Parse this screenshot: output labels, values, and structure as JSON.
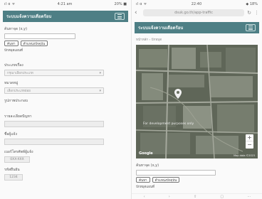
{
  "left": {
    "status": {
      "carrier": "ıl ɑ ᯤ",
      "time": "4:21 am",
      "battery": "20% ■"
    },
    "header": {
      "title": "ระบบแจ้งความเดือดร้อน"
    },
    "search": {
      "label": "ค้นหาจุด (x,y)",
      "placeholder": "",
      "btn_search": "ค้นหา",
      "btn_location": "ตำแหน่งปัจจุบัน",
      "note": "ปักหมุดแผนที่"
    },
    "form": {
      "type_label": "ประเภทเรื่อง",
      "type_value": "กรุณาเลือกประเภท",
      "subtype_label": "หมวดหมู่",
      "subtype_value": "เลือกประเภทย่อย",
      "photo_label": "รูปภาพประกอบ",
      "desc_label": "รายละเอียดปัญหา",
      "name_label": "ชื่อผู้แจ้ง",
      "phone_label": "เบอร์โทรศัพท์ผู้แจ้ง",
      "phone_value": "0XX-XXX",
      "code_label": "รหัสยืนยัน",
      "code_value": "1234"
    }
  },
  "right": {
    "status": {
      "carrier": "ıl ɑ ᯤ",
      "time": "22:40",
      "battery": "◆ 18%"
    },
    "browser": {
      "back": "‹",
      "url": "dsuk.go.th/app-traffic",
      "refresh": "↻",
      "more": "⋮"
    },
    "header": {
      "title": "ระบบแจ้งความเดือดร้อน"
    },
    "breadcrumb": "หน้าหลัก  ›  ปักหมุด",
    "map": {
      "label": "For development purposes only",
      "zoom_in": "+",
      "zoom_out": "−",
      "brand": "Google",
      "terms": "Map data ©2023"
    },
    "search": {
      "label": "ค้นหาจุด (x,y)",
      "btn_search": "ค้นหา",
      "btn_location": "ตำแหน่งปัจจุบัน",
      "note": "ปักหมุดแผนที่"
    },
    "bottomnav": [
      "‹",
      "›",
      "⇧",
      "▢",
      "⋯"
    ]
  },
  "colors": {
    "header": "#4e7f85",
    "map": "#6b7263"
  }
}
